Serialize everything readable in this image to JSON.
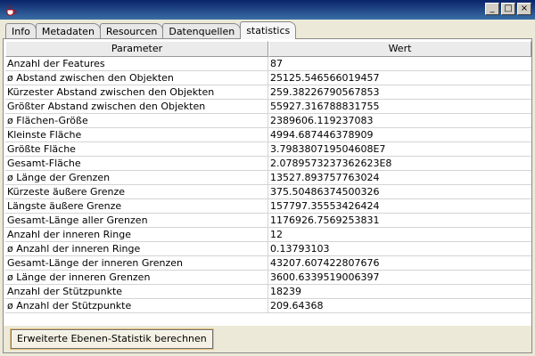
{
  "window": {
    "icon": "java-coffee-icon",
    "controls": {
      "minimize": "_",
      "maximize": "□",
      "close": "×"
    }
  },
  "tabs": [
    {
      "label": "Info",
      "active": false
    },
    {
      "label": "Metadaten",
      "active": false
    },
    {
      "label": "Resourcen",
      "active": false
    },
    {
      "label": "Datenquellen",
      "active": false
    },
    {
      "label": "statistics",
      "active": true
    }
  ],
  "table": {
    "columns": [
      "Parameter",
      "Wert"
    ],
    "rows": [
      [
        "Anzahl der Features",
        "87"
      ],
      [
        "ø Abstand zwischen den Objekten",
        "25125.546566019457"
      ],
      [
        "Kürzester Abstand zwischen den Objekten",
        "259.38226790567853"
      ],
      [
        "Größter Abstand zwischen den Objekten",
        "55927.316788831755"
      ],
      [
        "ø Flächen-Größe",
        "2389606.119237083"
      ],
      [
        "Kleinste Fläche",
        "4994.687446378909"
      ],
      [
        "Größte Fläche",
        "3.798380719504608E7"
      ],
      [
        "Gesamt-Fläche",
        "2.07895732373626​23E8"
      ],
      [
        "ø Länge der Grenzen",
        "13527.893757763024"
      ],
      [
        "Kürzeste äußere Grenze",
        "375.50486374500326"
      ],
      [
        "Längste äußere Grenze",
        "157797.35553426424"
      ],
      [
        "Gesamt-Länge aller Grenzen",
        "1176926.7569253831"
      ],
      [
        "Anzahl der inneren Ringe",
        "12"
      ],
      [
        "ø Anzahl der inneren Ringe",
        "0.13793103"
      ],
      [
        "Gesamt-Länge der inneren Grenzen",
        "43207.607422807676"
      ],
      [
        "ø Länge der inneren Grenzen",
        "3600.6339519006397"
      ],
      [
        "Anzahl der Stützpunkte",
        "18239"
      ],
      [
        "ø Anzahl der Stützpunkte",
        "209.64368"
      ]
    ]
  },
  "footer": {
    "compute_button_label": "Erweiterte Ebenen-Statistik berechnen"
  },
  "colors": {
    "titlebar_start": "#0a246a",
    "titlebar_end": "#3a6ea5",
    "window_bg": "#ece9d8"
  }
}
